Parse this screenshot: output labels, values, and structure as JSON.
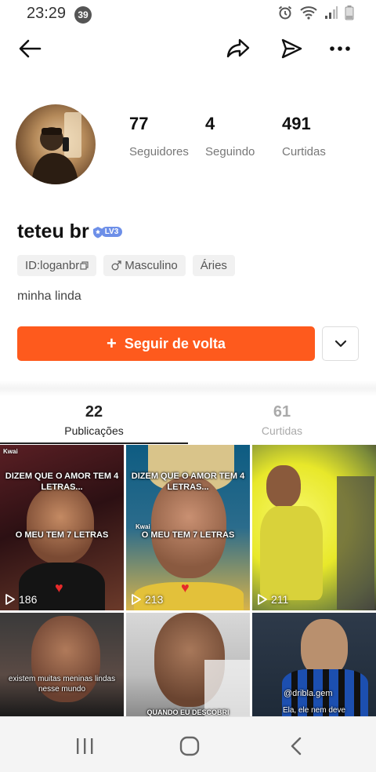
{
  "status_bar": {
    "time": "23:29",
    "notification_count": "39"
  },
  "profile": {
    "stats": [
      {
        "value": "77",
        "label": "Seguidores"
      },
      {
        "value": "4",
        "label": "Seguindo"
      },
      {
        "value": "491",
        "label": "Curtidas"
      }
    ],
    "username": "teteu br",
    "level": "LV3",
    "tags": {
      "id": "ID:loganbr",
      "gender": "Masculino",
      "sign": "Áries"
    },
    "bio": "minha linda"
  },
  "actions": {
    "follow_back_label": "Seguir de volta",
    "accent_color": "#fe5a1d"
  },
  "tabs": [
    {
      "count": "22",
      "label": "Publicações",
      "active": true
    },
    {
      "count": "61",
      "label": "Curtidas",
      "active": false
    }
  ],
  "posts": [
    {
      "caption_top": "DIZEM QUE O AMOR TEM 4 LETRAS...",
      "caption_mid": "O MEU TEM 7 LETRAS",
      "views": "186",
      "watermark": "Kwai"
    },
    {
      "caption_top": "DIZEM QUE O AMOR TEM 4 LETRAS...",
      "caption_mid": "O MEU TEM 7 LETRAS",
      "views": "213",
      "watermark": "Kwai"
    },
    {
      "caption_top": "",
      "caption_mid": "",
      "views": "211",
      "watermark": ""
    },
    {
      "caption_top": "existem muitas meninas lindas nesse mundo",
      "caption_mid": "",
      "views": "",
      "watermark": ""
    },
    {
      "caption_top": "QUANDO EU DESCOBRI",
      "caption_mid": "",
      "views": "",
      "watermark": ""
    },
    {
      "caption_top": "@dribla.gem",
      "caption_mid": "Ela, ele nem deve",
      "views": "",
      "watermark": ""
    }
  ],
  "icons": {
    "back": "arrow-left-icon",
    "share": "share-arrow-icon",
    "send": "paper-plane-icon",
    "more": "more-dots-icon",
    "dropdown": "chevron-down-icon",
    "gender": "male-symbol-icon",
    "copy": "copy-icon",
    "play": "play-icon"
  }
}
